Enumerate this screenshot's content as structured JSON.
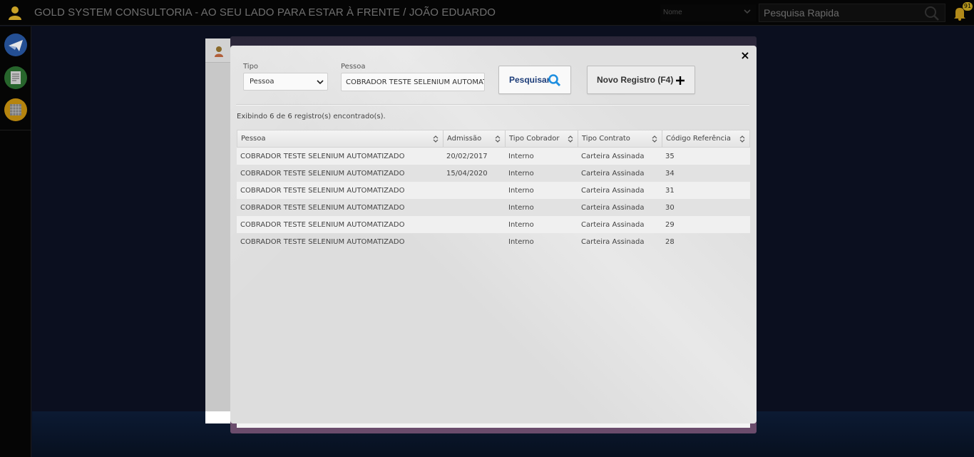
{
  "header": {
    "title": "GOLD SYSTEM CONSULTORIA - AO SEU LADO PARA ESTAR À FRENTE / JOÃO EDUARDO",
    "filter_select": "Nome",
    "quick_search_placeholder": "Pesquisa Rapida",
    "notifications_badge": "91"
  },
  "sidebar": {
    "items": [
      {
        "icon": "plane-icon",
        "color": "#2a5fb0"
      },
      {
        "icon": "document-icon",
        "color": "#2e7d32"
      },
      {
        "icon": "calendar-icon",
        "color": "#c08a12"
      }
    ]
  },
  "modal": {
    "close_label": "×",
    "tipo_label": "Tipo",
    "tipo_value": "Pessoa",
    "pessoa_label": "Pessoa",
    "pessoa_value": "COBRADOR TESTE SELENIUM AUTOMAT",
    "search_button": "Pesquisar",
    "new_button": "Novo Registro (F4)",
    "result_count": "Exibindo 6 de 6 registro(s) encontrado(s).",
    "columns": [
      "Pessoa",
      "Admissão",
      "Tipo Cobrador",
      "Tipo Contrato",
      "Código Referência"
    ],
    "rows": [
      [
        "COBRADOR TESTE SELENIUM AUTOMATIZADO",
        "20/02/2017",
        "Interno",
        "Carteira Assinada",
        "35"
      ],
      [
        "COBRADOR TESTE SELENIUM AUTOMATIZADO",
        "15/04/2020",
        "Interno",
        "Carteira Assinada",
        "34"
      ],
      [
        "COBRADOR TESTE SELENIUM AUTOMATIZADO",
        "",
        "Interno",
        "Carteira Assinada",
        "31"
      ],
      [
        "COBRADOR TESTE SELENIUM AUTOMATIZADO",
        "",
        "Interno",
        "Carteira Assinada",
        "30"
      ],
      [
        "COBRADOR TESTE SELENIUM AUTOMATIZADO",
        "",
        "Interno",
        "Carteira Assinada",
        "29"
      ],
      [
        "COBRADOR TESTE SELENIUM AUTOMATIZADO",
        "",
        "Interno",
        "Carteira Assinada",
        "28"
      ]
    ]
  }
}
